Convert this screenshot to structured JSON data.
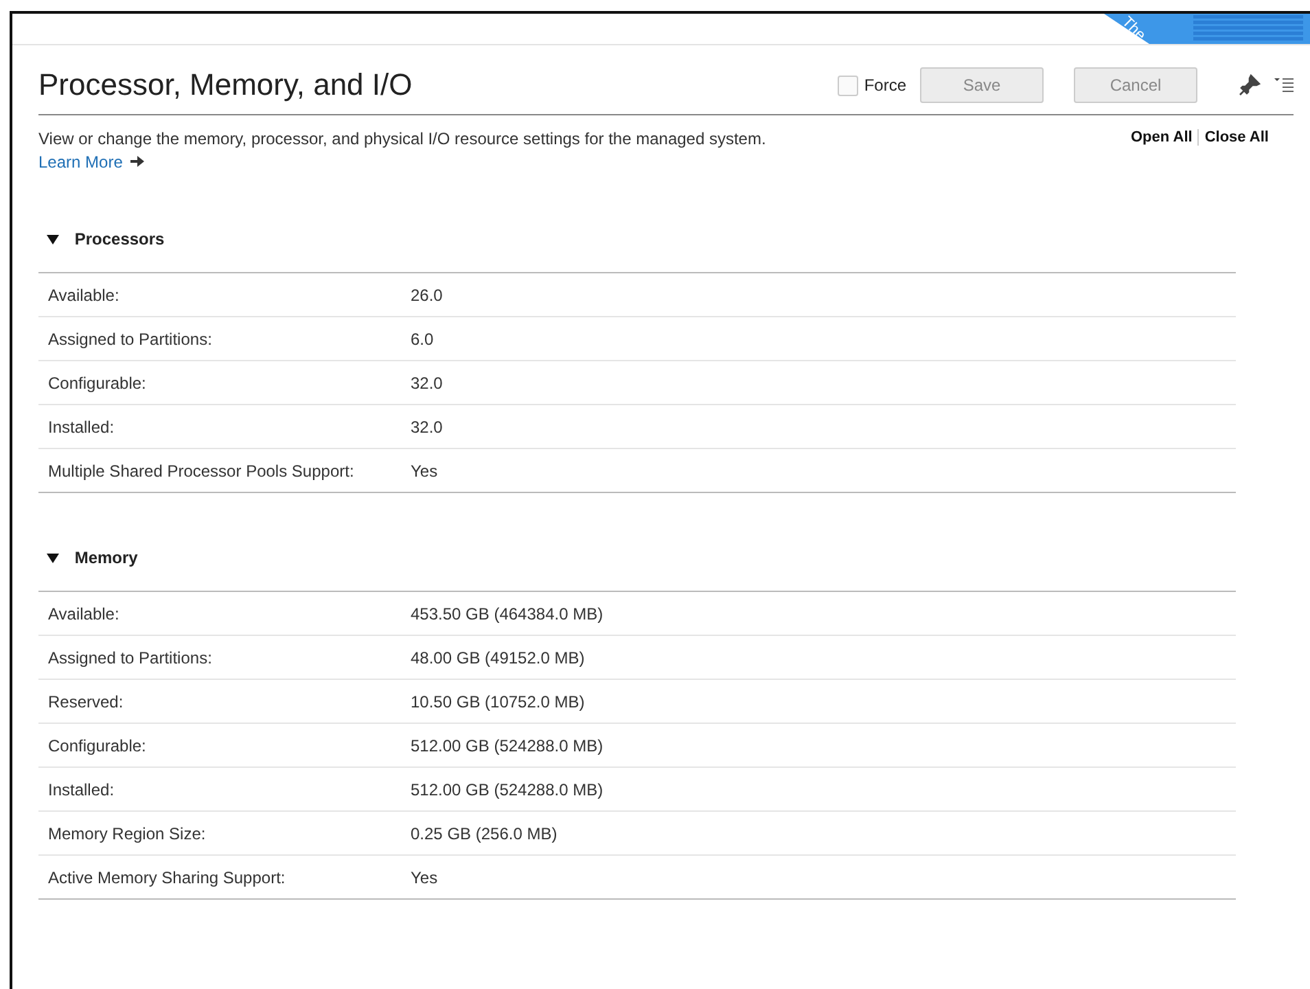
{
  "banner": {
    "text": "The"
  },
  "title": "Processor, Memory, and I/O",
  "force": {
    "label": "Force",
    "checked": false
  },
  "buttons": [
    {
      "label": "Save",
      "disabled": true
    },
    {
      "label": "Cancel",
      "disabled": true
    }
  ],
  "description": "View or change the memory, processor, and physical I/O resource settings for the managed system.",
  "learn_more": "Learn More",
  "open_all": "Open All",
  "close_all": "Close All",
  "sections": [
    {
      "title": "Processors",
      "expanded": true,
      "rows": [
        {
          "label": "Available:",
          "value": "26.0"
        },
        {
          "label": "Assigned to Partitions:",
          "value": "6.0"
        },
        {
          "label": "Configurable:",
          "value": "32.0"
        },
        {
          "label": "Installed:",
          "value": "32.0"
        },
        {
          "label": "Multiple Shared Processor Pools Support:",
          "value": "Yes"
        }
      ]
    },
    {
      "title": "Memory",
      "expanded": true,
      "rows": [
        {
          "label": "Available:",
          "value": "453.50 GB (464384.0 MB)"
        },
        {
          "label": "Assigned to Partitions:",
          "value": "48.00 GB (49152.0 MB)"
        },
        {
          "label": "Reserved:",
          "value": "10.50 GB (10752.0 MB)"
        },
        {
          "label": "Configurable:",
          "value": "512.00 GB (524288.0 MB)"
        },
        {
          "label": "Installed:",
          "value": "512.00 GB (524288.0 MB)"
        },
        {
          "label": "Memory Region Size:",
          "value": "0.25 GB (256.0 MB)"
        },
        {
          "label": "Active Memory Sharing Support:",
          "value": "Yes"
        }
      ]
    }
  ]
}
